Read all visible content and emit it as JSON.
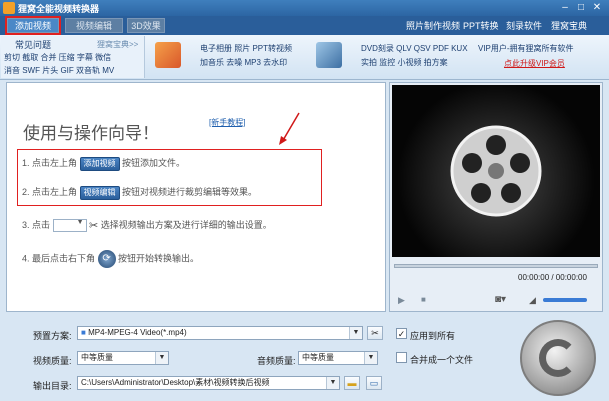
{
  "window": {
    "title": "狸窝全能视频转换器",
    "min_icon": "minimize-icon",
    "max_icon": "maximize-icon",
    "close_icon": "close-icon"
  },
  "tabs": [
    {
      "label": "添加视频",
      "active": true
    },
    {
      "label": "视频编辑",
      "active": false
    },
    {
      "label": "3D效果",
      "active": false
    }
  ],
  "top_links": [
    "照片制作视频",
    "PPT转换",
    "刻录软件",
    "狸窝宝典"
  ],
  "feature_bar": {
    "faq_label": "常见问题",
    "baodian_label": "狸窝宝典>>",
    "faq_lines": [
      "剪切 截取 合并 压缩 字幕 微信",
      "消音 SWF 片头 GIF 双音轨 MV"
    ],
    "ppt_lines": [
      "电子相册 照片 PPT转视频",
      "加音乐 去噪 MP3 去水印"
    ],
    "dvd_lines": [
      "DVD刻录 QLV QSV PDF KUX",
      "实拍 监控 小视频 拍方案"
    ],
    "vip_line": "VIP用户-拥有狸窝所有软件",
    "vip_link": "点此升级VIP会员"
  },
  "guide": {
    "heading": "使用与操作向导！",
    "new_tutorial": "[新手教程]",
    "steps": [
      {
        "prefix": "1. 点击左上角",
        "button": "添加视频",
        "suffix": "按钮添加文件。"
      },
      {
        "prefix": "2. 点击左上角",
        "button": "视频编辑",
        "suffix": "按钮对视频进行裁剪编辑等效果。"
      },
      {
        "prefix": "3. 点击",
        "suffix": "选择视频输出方案及进行详细的输出设置。"
      },
      {
        "prefix": "4. 最后点击右下角",
        "suffix": "按钮开始转换输出。"
      }
    ]
  },
  "player": {
    "time": "00:00:00 / 00:00:00",
    "icons": [
      "play-icon",
      "stop-icon",
      "snapshot-icon",
      "volume-icon"
    ]
  },
  "settings": {
    "preset_label": "预置方案:",
    "preset_value": "MP4-MPEG-4 Video(*.mp4)",
    "apply_all_label": "应用到所有",
    "apply_all_checked": true,
    "video_quality_label": "视频质量:",
    "video_quality_value": "中等质量",
    "audio_quality_label": "音频质量:",
    "audio_quality_value": "中等质量",
    "merge_label": "合并成一个文件",
    "merge_checked": false,
    "output_label": "输出目录:",
    "output_value": "C:\\Users\\Administrator\\Desktop\\素材\\视频转换后视频"
  },
  "colors": {
    "accent": "#2b66a8",
    "highlight_red": "#e02020",
    "vip_red": "#d01818"
  }
}
